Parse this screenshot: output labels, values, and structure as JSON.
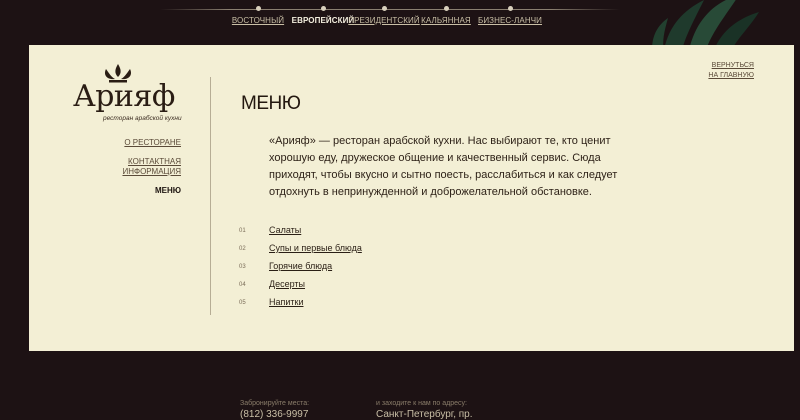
{
  "topnav": {
    "items": [
      {
        "label": "ВОСТОЧНЫЙ",
        "active": false
      },
      {
        "label": "ЕВРОПЕЙСКИЙ",
        "active": true
      },
      {
        "label": "ПРЕЗИДЕНТСКИЙ",
        "active": false
      },
      {
        "label": "КАЛЬЯННАЯ",
        "active": false
      },
      {
        "label": "БИЗНЕС-ЛАНЧИ",
        "active": false
      }
    ]
  },
  "logo": {
    "word": "Арияф",
    "tagline": "ресторан арабской кухни"
  },
  "sidenav": {
    "items": [
      {
        "label": "О РЕСТОРАНЕ"
      },
      {
        "label": "КОНТАКТНАЯ ИНФОРМАЦИЯ"
      },
      {
        "label": "МЕНЮ",
        "current": true
      }
    ]
  },
  "back_link": {
    "line1": "ВЕРНУТЬСЯ",
    "line2": "НА ГЛАВНУЮ"
  },
  "page": {
    "title": "МЕНЮ",
    "intro": "«Арияф» — ресторан арабской кухни. Нас выбирают те, кто ценит хорошую еду, дружеское общение и качественный сервис. Сюда приходят, чтобы вкусно и сытно поесть, расслабиться и как следует отдохнуть в непринужденной и доброжелательной обстановке."
  },
  "menu_items": [
    {
      "num": "01",
      "name": "Салаты"
    },
    {
      "num": "02",
      "name": "Супы и первые блюда"
    },
    {
      "num": "03",
      "name": "Горячие блюда"
    },
    {
      "num": "04",
      "name": "Десерты"
    },
    {
      "num": "05",
      "name": "Напитки"
    }
  ],
  "footer": {
    "reserve_label": "Забронируйте места:",
    "reserve_value": "(812) 336-9997",
    "address_label": "и заходите к нам по адресу:",
    "address_value": "Санкт-Петербург, пр."
  },
  "colors": {
    "background": "#1d1214",
    "panel": "#f3efd5",
    "text": "#2b1f16"
  }
}
